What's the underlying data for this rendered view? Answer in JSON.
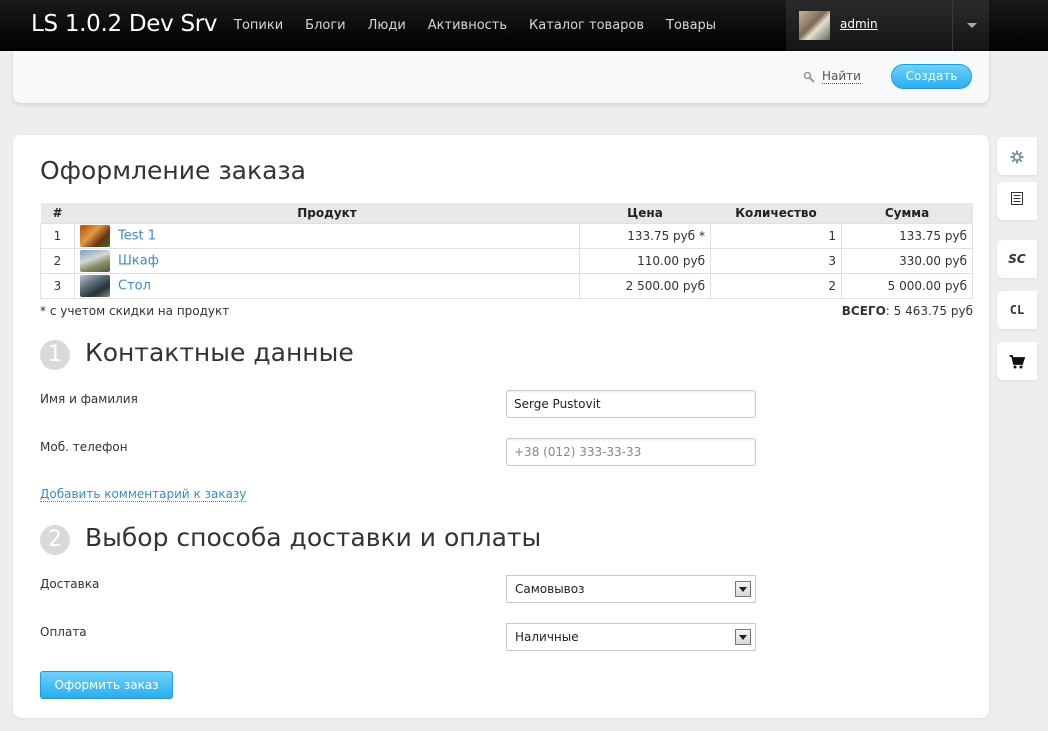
{
  "header": {
    "brand": "LS 1.0.2 Dev Srv",
    "nav": [
      "Топики",
      "Блоги",
      "Люди",
      "Активность",
      "Каталог товаров",
      "Товары"
    ],
    "username": "admin"
  },
  "toolbar": {
    "search_label": "Найти",
    "create_label": "Создать"
  },
  "page": {
    "title": "Оформление заказа"
  },
  "order_table": {
    "headers": {
      "num": "#",
      "product": "Продукт",
      "price": "Цена",
      "qty": "Количество",
      "sum": "Сумма"
    },
    "rows": [
      {
        "num": "1",
        "product": "Test 1",
        "price": "133.75 руб *",
        "qty": "1",
        "sum": "133.75 руб"
      },
      {
        "num": "2",
        "product": "Шкаф",
        "price": "110.00 руб",
        "qty": "3",
        "sum": "330.00 руб"
      },
      {
        "num": "3",
        "product": "Стол",
        "price": "2 500.00 руб",
        "qty": "2",
        "sum": "5 000.00 руб"
      }
    ],
    "note": "* с учетом скидки на продукт",
    "total_label": "ВСЕГО",
    "total_value": ": 5 463.75 руб"
  },
  "contact": {
    "step": "1",
    "title": "Контактные данные",
    "name_label": "Имя и фамилия",
    "name_value": "Serge Pustovit",
    "phone_label": "Моб. телефон",
    "phone_placeholder": "+38 (012) 333-33-33",
    "comment_link": "Добавить комментарий к заказу"
  },
  "delivery": {
    "step": "2",
    "title": "Выбор способа доставки и оплаты",
    "delivery_label": "Доставка",
    "delivery_value": "Самовывоз",
    "payment_label": "Оплата",
    "payment_value": "Наличные",
    "submit_label": "Оформить заказ"
  },
  "right_toolbar": {
    "items": [
      "gear-icon",
      "list-icon",
      "SC",
      "CL",
      "cart-icon"
    ],
    "sc": "SC",
    "cl": "CL"
  }
}
